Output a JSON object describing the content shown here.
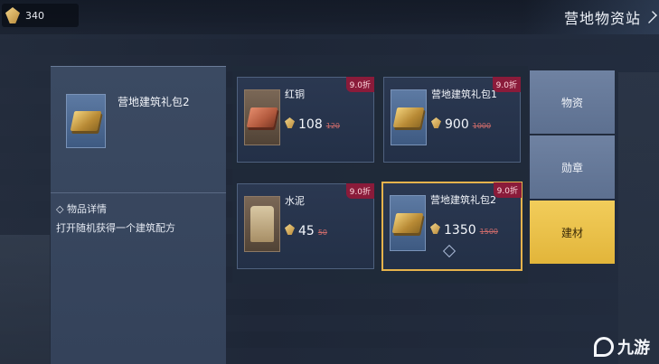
{
  "header": {
    "currency_value": "340",
    "shop_title": "营地物资站"
  },
  "detail": {
    "item_name": "营地建筑礼包2",
    "section_title": "◇ 物品详情",
    "description": "打开随机获得一个建筑配方"
  },
  "items": [
    {
      "name": "红铜",
      "price": "108",
      "old_price": "120",
      "badge": "9.0折",
      "icon": "copper-ingot-icon"
    },
    {
      "name": "营地建筑礼包1",
      "price": "900",
      "old_price": "1000",
      "badge": "9.0折",
      "icon": "gold-bar-icon"
    },
    {
      "name": "水泥",
      "price": "45",
      "old_price": "50",
      "badge": "9.0折",
      "icon": "cement-bag-icon"
    },
    {
      "name": "营地建筑礼包2",
      "price": "1350",
      "old_price": "1500",
      "badge": "9.0折",
      "icon": "gold-bar-icon",
      "selected": true
    }
  ],
  "tabs": [
    {
      "label": "物资",
      "active": false
    },
    {
      "label": "勋章",
      "active": false
    },
    {
      "label": "建材",
      "active": true
    }
  ],
  "watermark": {
    "text": "九游"
  },
  "colors": {
    "active_tab": "#f2cd5b",
    "badge": "#8a1b3a",
    "selected_border": "#e6b34c"
  }
}
